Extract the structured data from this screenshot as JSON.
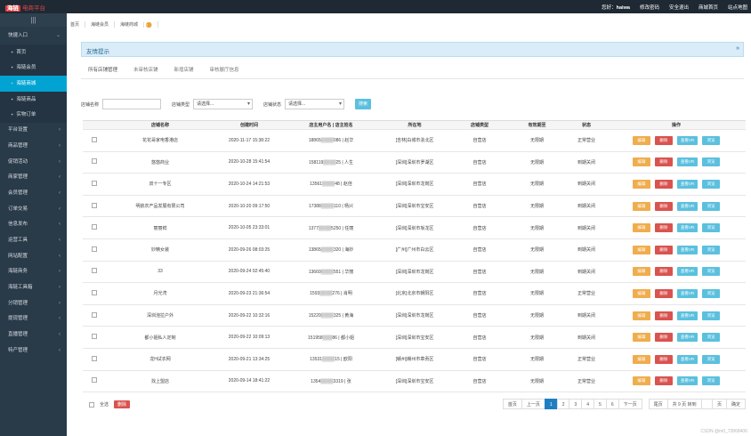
{
  "header": {
    "logo_mark": "海链",
    "logo_sub": "电商平台",
    "greeting_prefix": "您好：",
    "username": "haiwa",
    "links": [
      "修改密码",
      "安全退出",
      "商城首页",
      "站点地图"
    ]
  },
  "sidebar": {
    "collapse_icon": "|||",
    "items": [
      {
        "label": "快捷入口",
        "level": 1,
        "arrow": "⌄"
      },
      {
        "label": "首页",
        "level": 2
      },
      {
        "label": "海链会员",
        "level": 2
      },
      {
        "label": "海链商城",
        "level": 2,
        "active": true
      },
      {
        "label": "海链商品",
        "level": 2
      },
      {
        "label": "实物订单",
        "level": 2
      },
      {
        "label": "平台设置",
        "level": 1,
        "arrow": "‹"
      },
      {
        "label": "商品管理",
        "level": 1,
        "arrow": "‹"
      },
      {
        "label": "促销活动",
        "level": 1,
        "arrow": "‹"
      },
      {
        "label": "商家管理",
        "level": 1,
        "arrow": "‹"
      },
      {
        "label": "会员管理",
        "level": 1,
        "arrow": "‹"
      },
      {
        "label": "订单交易",
        "level": 1,
        "arrow": "‹"
      },
      {
        "label": "信息发布",
        "level": 1,
        "arrow": "‹"
      },
      {
        "label": "运营工具",
        "level": 1,
        "arrow": "‹"
      },
      {
        "label": "网站配置",
        "level": 1,
        "arrow": "‹"
      },
      {
        "label": "海链商务",
        "level": 1,
        "arrow": "‹"
      },
      {
        "label": "海链工具箱",
        "level": 1,
        "arrow": "‹"
      },
      {
        "label": "分销管理",
        "level": 1,
        "arrow": "‹"
      },
      {
        "label": "提现管理",
        "level": 1,
        "arrow": "‹"
      },
      {
        "label": "直播管理",
        "level": 1,
        "arrow": "‹"
      },
      {
        "label": "特产管理",
        "level": 1,
        "arrow": "‹"
      }
    ]
  },
  "breadcrumb": [
    "首页",
    "海链会员",
    "海链商城"
  ],
  "banner": {
    "title": "友情提示",
    "toggle": "»"
  },
  "tabs": [
    "所有店铺管理",
    "未审核店铺",
    "新增店铺",
    "审核展厅信息"
  ],
  "filter": {
    "name_label": "店铺名称",
    "type_label": "店铺类型",
    "type_value": "请选择...",
    "status_label": "店铺状态",
    "status_value": "请选择...",
    "search_label": "搜索"
  },
  "table": {
    "headers": [
      "",
      "店铺名称",
      "创建时间",
      "店主用户名 | 店主姓名",
      "所在地",
      "店铺类型",
      "有效期至",
      "状态",
      "操作"
    ],
    "ops": [
      "编辑",
      "删除",
      "查看VR",
      "浏览"
    ],
    "rows": [
      {
        "name": "花花哥家电香港店",
        "created": "2020-11-17 15:38:22",
        "owner": "18865▒▒▒▒086 | 赵华",
        "location": "[吉林]白城市洮北区",
        "type": "自营店",
        "expire": "无限期",
        "status": "正常营业"
      },
      {
        "name": "悠悠商业",
        "created": "2020-10-28 15:41:54",
        "owner": "158119▒▒▒▒25 | 人生",
        "location": "[深圳]深圳市罗湖区",
        "type": "自营店",
        "expire": "无限期",
        "status": "到期关闭"
      },
      {
        "name": "双十一专区",
        "created": "2020-10-24 14:21:53",
        "owner": "13561▒▒▒▒48 | 赵佳",
        "location": "[深圳]深圳市龙岗区",
        "type": "自营店",
        "expire": "无限期",
        "status": "到期关闭"
      },
      {
        "name": "明航农产品发展有限公司",
        "created": "2020-10-20 09:17:50",
        "owner": "17388▒▒▒▒110 | 杨兴",
        "location": "[深圳]深圳市宝安区",
        "type": "自营店",
        "expire": "无限期",
        "status": "到期关闭"
      },
      {
        "name": "丽丽鲜",
        "created": "2020-10-05 23:33:01",
        "owner": "1377▒▒▒▒5250 | 任丽",
        "location": "[深圳]深圳市坂龙区",
        "type": "自营店",
        "expire": "无限期",
        "status": "到期关闭"
      },
      {
        "name": "妙精女装",
        "created": "2020-09-26 08:03:25",
        "owner": "13865▒▒▒▒320 | 海妙",
        "location": "[广州]广州市白云区",
        "type": "自营店",
        "expire": "无限期",
        "status": "到期关闭"
      },
      {
        "name": "33",
        "created": "2020-09-24 02:45:40",
        "owner": "13660▒▒▒▒551 | 华丽",
        "location": "[深圳]深圳市龙岗区",
        "type": "自营店",
        "expire": "无限期",
        "status": "到期关闭"
      },
      {
        "name": "月光湾",
        "created": "2020-09-23 21:36:54",
        "owner": "1593▒▒▒▒276 | 肖明",
        "location": "[北京]北京市朝阳区",
        "type": "自营店",
        "expire": "无限期",
        "status": "正常营业"
      },
      {
        "name": "深圳泡拉户外",
        "created": "2020-09-22 10:32:16",
        "owner": "15220▒▒▒▒325 | 黄海",
        "location": "[深圳]深圳市龙岗区",
        "type": "自营店",
        "expire": "无限期",
        "status": "到期关闭"
      },
      {
        "name": "都小姐私人定制",
        "created": "2020-09-22 10:09:13",
        "owner": "151958▒▒▒86 | 都小姐",
        "location": "[深圳]深圳市宝安区",
        "type": "自营店",
        "expire": "无限期",
        "status": "到期关闭"
      },
      {
        "name": "龙H试衣网",
        "created": "2020-09-21 13:34:25",
        "owner": "13531▒▒▒▒15 | 欧阳",
        "location": "[赣州]赣州市章贡区",
        "type": "自营店",
        "expire": "无限期",
        "status": "正常营业"
      },
      {
        "name": "找上盟店",
        "created": "2020-09-14 18:41:22",
        "owner": "1354▒▒▒▒3319 | 张",
        "location": "[深圳]深圳市宝安区",
        "type": "自营店",
        "expire": "无限期",
        "status": "正常营业"
      }
    ]
  },
  "footer": {
    "select_all": "全选",
    "bulk_delete": "删除",
    "pager": {
      "first": "首页",
      "prev": "上一页",
      "pages": [
        "1",
        "2",
        "3",
        "4",
        "5",
        "6"
      ],
      "current": "1",
      "next": "下一页",
      "last": "尾页",
      "total_text": "共 9 页 转到",
      "page_suffix": "页",
      "confirm": "确定"
    }
  },
  "watermark": "CSDN @m0_72868406"
}
